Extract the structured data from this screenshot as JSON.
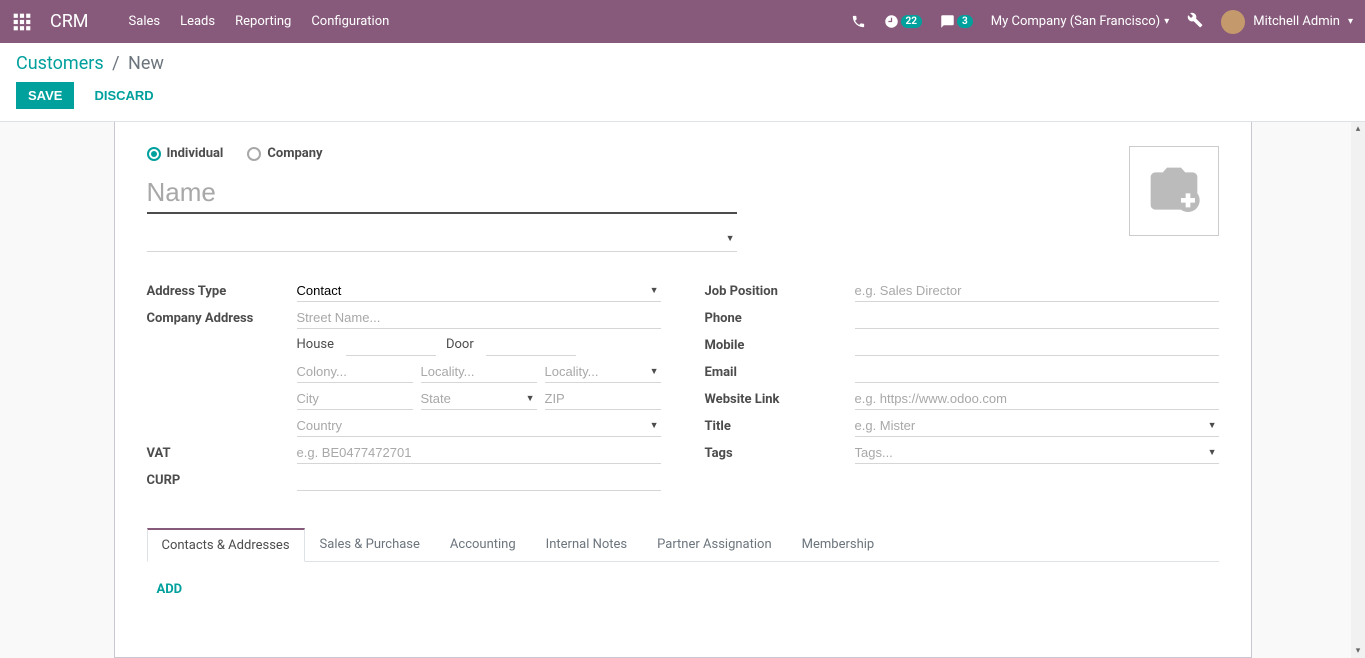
{
  "navbar": {
    "brand": "CRM",
    "menu": [
      "Sales",
      "Leads",
      "Reporting",
      "Configuration"
    ],
    "activity_count": "22",
    "message_count": "3",
    "company": "My Company (San Francisco)",
    "user": "Mitchell Admin"
  },
  "breadcrumb": {
    "parent": "Customers",
    "current": "New"
  },
  "buttons": {
    "save": "SAVE",
    "discard": "DISCARD"
  },
  "type_radio": {
    "individual": "Individual",
    "company": "Company",
    "selected": "individual"
  },
  "name_placeholder": "Name",
  "left": {
    "address_type_label": "Address Type",
    "address_type_value": "Contact",
    "company_address_label": "Company Address",
    "street_ph": "Street Name...",
    "house_label": "House",
    "door_label": "Door",
    "colony_ph": "Colony...",
    "locality1_ph": "Locality...",
    "locality2_ph": "Locality...",
    "city_ph": "City",
    "state_ph": "State",
    "zip_ph": "ZIP",
    "country_ph": "Country",
    "vat_label": "VAT",
    "vat_ph": "e.g. BE0477472701",
    "curp_label": "CURP"
  },
  "right": {
    "job_label": "Job Position",
    "job_ph": "e.g. Sales Director",
    "phone_label": "Phone",
    "mobile_label": "Mobile",
    "email_label": "Email",
    "website_label": "Website Link",
    "website_ph": "e.g. https://www.odoo.com",
    "title_label": "Title",
    "title_ph": "e.g. Mister",
    "tags_label": "Tags",
    "tags_ph": "Tags..."
  },
  "tabs": [
    "Contacts & Addresses",
    "Sales & Purchase",
    "Accounting",
    "Internal Notes",
    "Partner Assignation",
    "Membership"
  ],
  "tab_active": 0,
  "add_label": "ADD"
}
